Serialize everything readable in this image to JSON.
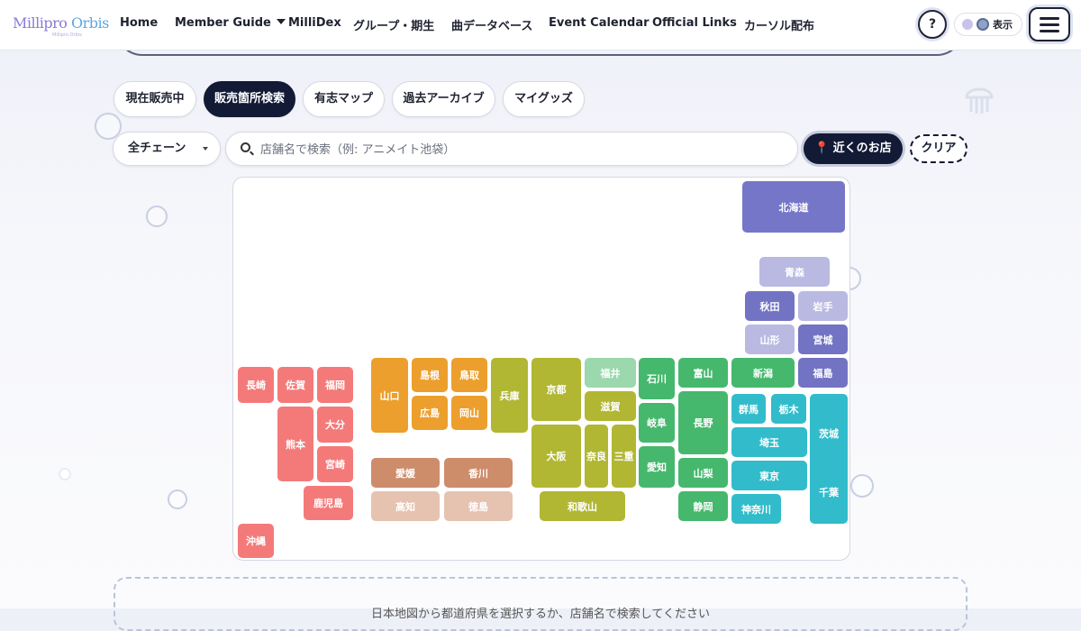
{
  "header": {
    "logo_text": "Millipro",
    "logo_accent": "Orbis",
    "logo_sub": "Millipro Orbis",
    "nav": [
      "Home",
      "Member Guide",
      "MilliDex",
      "グループ・期生",
      "曲データベース",
      "Event Calendar",
      "Official Links",
      "カーソル配布"
    ],
    "help_label": "?",
    "display_label": "表示"
  },
  "tabs": [
    {
      "label": "現在販売中",
      "active": false
    },
    {
      "label": "販売箇所検索",
      "active": true
    },
    {
      "label": "有志マップ",
      "active": false
    },
    {
      "label": "過去アーカイブ",
      "active": false
    },
    {
      "label": "マイグッズ",
      "active": false
    }
  ],
  "filters": {
    "chain_select": "全チェーン",
    "search_placeholder": "店舗名で検索（例: アニメイト池袋）",
    "near_button": "近くのお店",
    "clear_button": "クリア"
  },
  "regions": {
    "hokkaido": "#7676c9",
    "tohoku_light": "#b9b9e1",
    "tohoku_dark": "#7373c4",
    "kanto": "#32bccb",
    "chubu": "#45b86d",
    "hokuriku_light": "#9bd8ad",
    "kinki": "#b1b733",
    "chugoku": "#ec9f2c",
    "shikoku_dark": "#cd8c6a",
    "shikoku_light": "#e6c2b1",
    "kyushu": "#f47a7a"
  },
  "prefectures": [
    {
      "id": "hokkaido",
      "name": "北海道",
      "region": "hokkaido"
    },
    {
      "id": "aomori",
      "name": "青森",
      "region": "tohoku_light"
    },
    {
      "id": "akita",
      "name": "秋田",
      "region": "tohoku_dark"
    },
    {
      "id": "iwate",
      "name": "岩手",
      "region": "tohoku_light"
    },
    {
      "id": "yamagata",
      "name": "山形",
      "region": "tohoku_light"
    },
    {
      "id": "miyagi",
      "name": "宮城",
      "region": "tohoku_dark"
    },
    {
      "id": "fukushima",
      "name": "福島",
      "region": "tohoku_dark"
    },
    {
      "id": "ishikawa",
      "name": "石川",
      "region": "chubu"
    },
    {
      "id": "toyama",
      "name": "富山",
      "region": "chubu"
    },
    {
      "id": "niigata",
      "name": "新潟",
      "region": "chubu"
    },
    {
      "id": "fukui",
      "name": "福井",
      "region": "hokuriku_light"
    },
    {
      "id": "gifu",
      "name": "岐阜",
      "region": "chubu"
    },
    {
      "id": "nagano",
      "name": "長野",
      "region": "chubu"
    },
    {
      "id": "gunma",
      "name": "群馬",
      "region": "kanto"
    },
    {
      "id": "tochigi",
      "name": "栃木",
      "region": "kanto"
    },
    {
      "id": "ibaraki",
      "name": "茨城",
      "region": "kanto"
    },
    {
      "id": "saitama",
      "name": "埼玉",
      "region": "kanto"
    },
    {
      "id": "aichi",
      "name": "愛知",
      "region": "chubu"
    },
    {
      "id": "yamanashi",
      "name": "山梨",
      "region": "chubu"
    },
    {
      "id": "tokyo",
      "name": "東京",
      "region": "kanto"
    },
    {
      "id": "chiba",
      "name": "千葉",
      "region": "kanto"
    },
    {
      "id": "shizuoka",
      "name": "静岡",
      "region": "chubu"
    },
    {
      "id": "kanagawa",
      "name": "神奈川",
      "region": "kanto"
    },
    {
      "id": "kyoto",
      "name": "京都",
      "region": "kinki"
    },
    {
      "id": "shiga",
      "name": "滋賀",
      "region": "kinki"
    },
    {
      "id": "hyogo",
      "name": "兵庫",
      "region": "kinki"
    },
    {
      "id": "osaka",
      "name": "大阪",
      "region": "kinki"
    },
    {
      "id": "nara",
      "name": "奈良",
      "region": "kinki"
    },
    {
      "id": "mie",
      "name": "三重",
      "region": "kinki"
    },
    {
      "id": "wakayama",
      "name": "和歌山",
      "region": "kinki"
    },
    {
      "id": "yamaguchi",
      "name": "山口",
      "region": "chugoku"
    },
    {
      "id": "shimane",
      "name": "島根",
      "region": "chugoku"
    },
    {
      "id": "tottori",
      "name": "鳥取",
      "region": "chugoku"
    },
    {
      "id": "hiroshima",
      "name": "広島",
      "region": "chugoku"
    },
    {
      "id": "okayama",
      "name": "岡山",
      "region": "chugoku"
    },
    {
      "id": "ehime",
      "name": "愛媛",
      "region": "shikoku_dark"
    },
    {
      "id": "kagawa",
      "name": "香川",
      "region": "shikoku_dark"
    },
    {
      "id": "kochi",
      "name": "高知",
      "region": "shikoku_light"
    },
    {
      "id": "tokushima",
      "name": "徳島",
      "region": "shikoku_light"
    },
    {
      "id": "nagasaki",
      "name": "長崎",
      "region": "kyushu"
    },
    {
      "id": "saga",
      "name": "佐賀",
      "region": "kyushu"
    },
    {
      "id": "fukuoka",
      "name": "福岡",
      "region": "kyushu"
    },
    {
      "id": "oita",
      "name": "大分",
      "region": "kyushu"
    },
    {
      "id": "kumamoto",
      "name": "熊本",
      "region": "kyushu"
    },
    {
      "id": "miyazaki",
      "name": "宮崎",
      "region": "kyushu"
    },
    {
      "id": "kagoshima",
      "name": "鹿児島",
      "region": "kyushu"
    },
    {
      "id": "okinawa",
      "name": "沖縄",
      "region": "kyushu"
    }
  ],
  "info_text": "日本地図から都道府県を選択するか、店舗名で検索してください"
}
